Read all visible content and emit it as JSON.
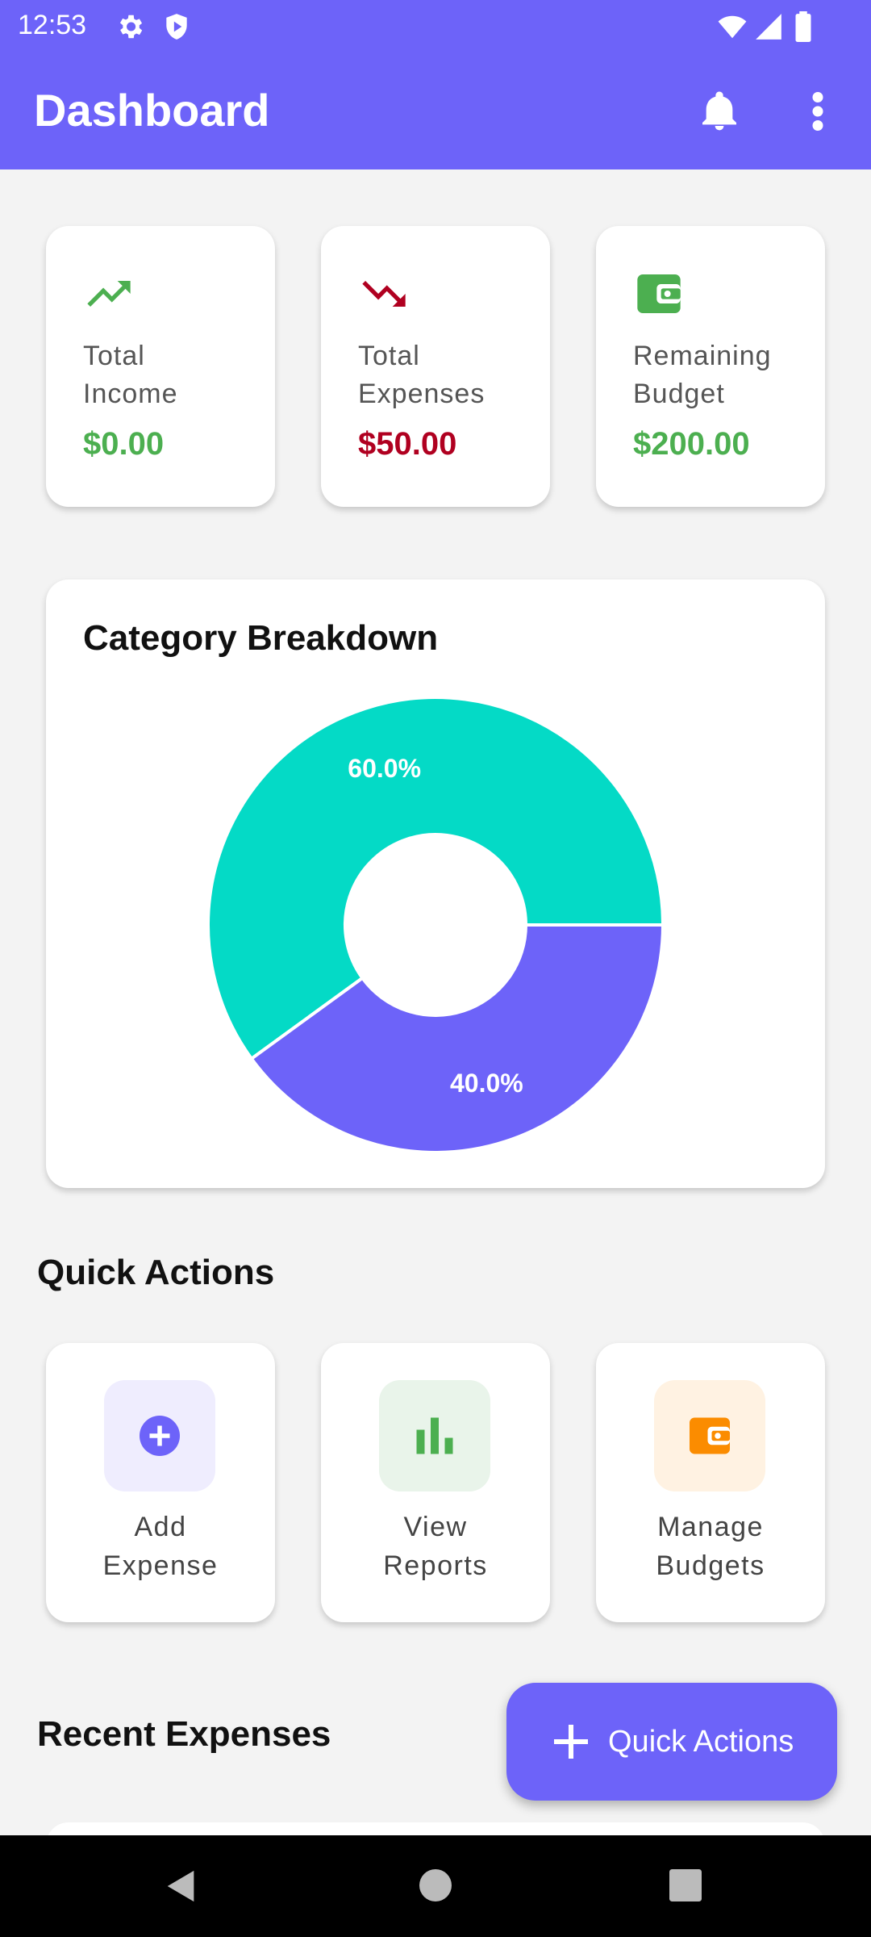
{
  "status_bar": {
    "time": "12:53"
  },
  "app_bar": {
    "title": "Dashboard"
  },
  "summary_cards": [
    {
      "label": "Total Income",
      "value": "$0.00",
      "icon": "trending-up-icon",
      "color": "#4caf50"
    },
    {
      "label": "Total Expenses",
      "value": "$50.00",
      "icon": "trending-down-icon",
      "color": "#b00020"
    },
    {
      "label": "Remaining Budget",
      "value": "$200.00",
      "icon": "wallet-icon",
      "color": "#4caf50"
    }
  ],
  "category_breakdown": {
    "title": "Category Breakdown"
  },
  "chart_data": {
    "type": "pie",
    "title": "Category Breakdown",
    "donut": true,
    "values": [
      60.0,
      40.0
    ],
    "labels": [
      "60.0%",
      "40.0%"
    ],
    "colors": [
      "#04dac6",
      "#6d63f9"
    ]
  },
  "quick_actions": {
    "title": "Quick Actions",
    "items": [
      {
        "label": "Add Expense",
        "icon": "add-circle-icon",
        "color": "#6d63f9",
        "bg": "#efedfe"
      },
      {
        "label": "View Reports",
        "icon": "bar-chart-icon",
        "color": "#4caf50",
        "bg": "#e9f4ea"
      },
      {
        "label": "Manage Budgets",
        "icon": "wallet-icon",
        "color": "#fb8c00",
        "bg": "#fff2e2"
      }
    ]
  },
  "recent_expenses": {
    "title": "Recent Expenses"
  },
  "fab": {
    "label": "Quick Actions"
  }
}
